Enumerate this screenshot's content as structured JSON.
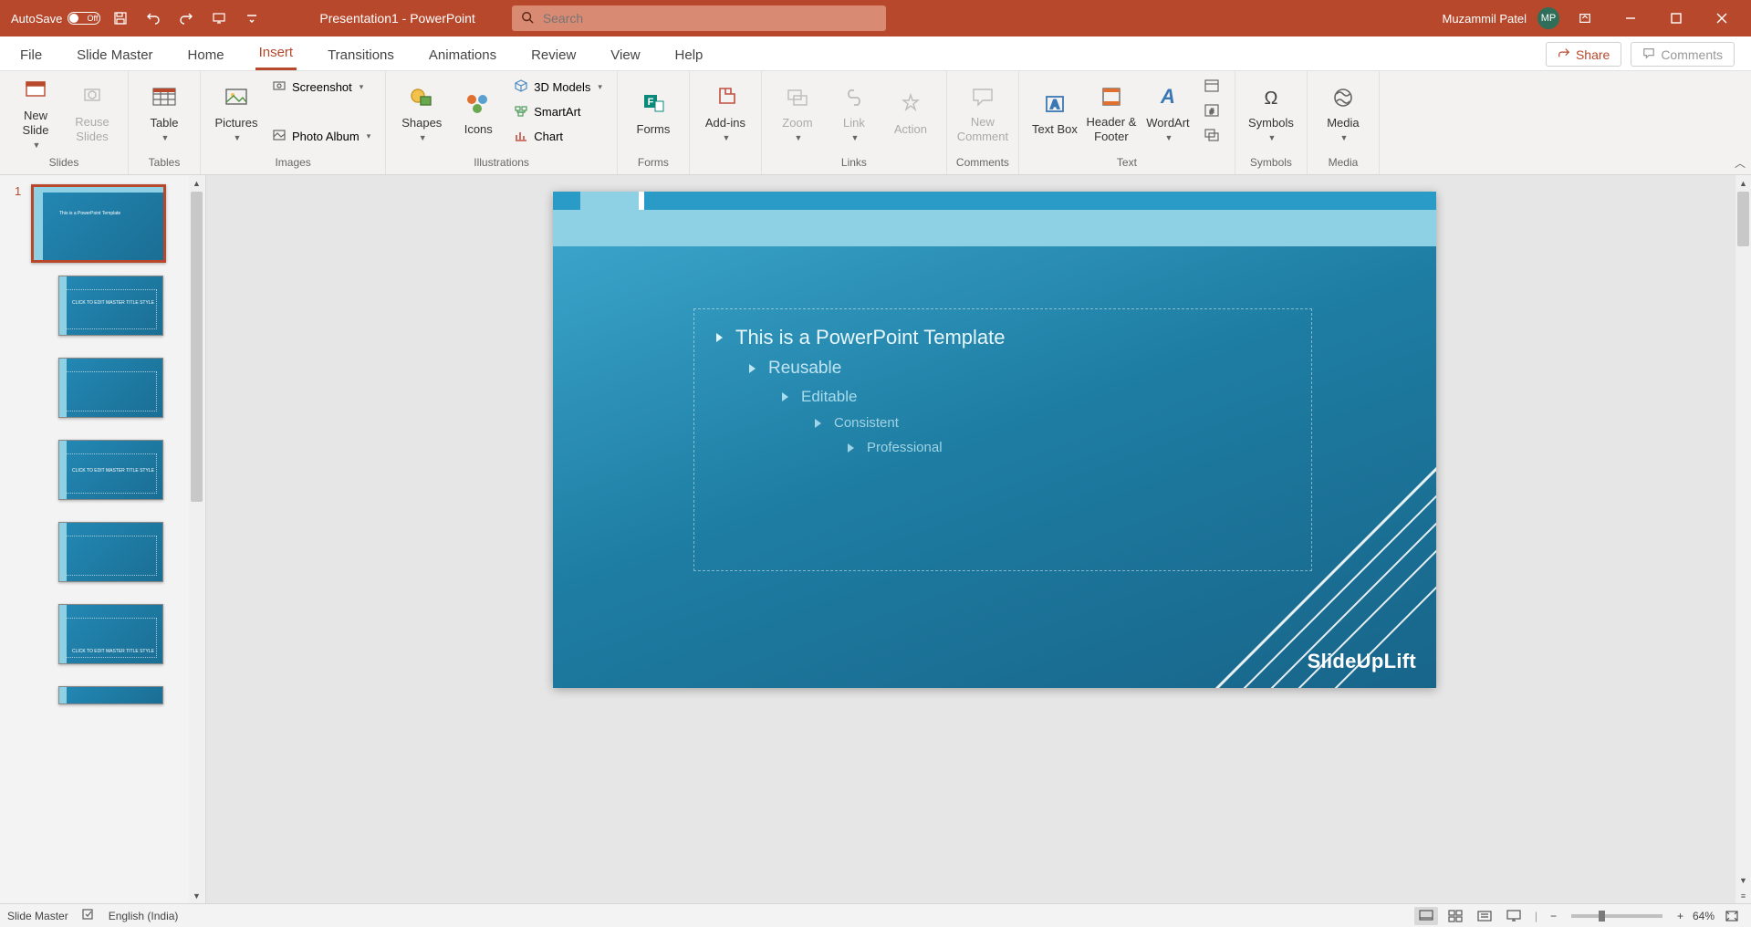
{
  "titlebar": {
    "autosave_label": "AutoSave",
    "autosave_state": "Off",
    "doc_title": "Presentation1 - PowerPoint",
    "search_placeholder": "Search",
    "user_name": "Muzammil Patel",
    "user_initials": "MP"
  },
  "tabs": {
    "file": "File",
    "slidemaster": "Slide Master",
    "home": "Home",
    "insert": "Insert",
    "transitions": "Transitions",
    "animations": "Animations",
    "review": "Review",
    "view": "View",
    "help": "Help",
    "share": "Share",
    "comments": "Comments"
  },
  "ribbon": {
    "groups": {
      "slides": "Slides",
      "tables": "Tables",
      "images": "Images",
      "illustrations": "Illustrations",
      "forms": "Forms",
      "addins_label": "",
      "links": "Links",
      "comments": "Comments",
      "text": "Text",
      "symbols": "Symbols",
      "media": "Media"
    },
    "buttons": {
      "new_slide": "New Slide",
      "reuse_slides": "Reuse Slides",
      "table": "Table",
      "pictures": "Pictures",
      "screenshot": "Screenshot",
      "smartart": "SmartArt",
      "photo_album": "Photo Album",
      "shapes": "Shapes",
      "icons": "Icons",
      "models3d": "3D Models",
      "chart": "Chart",
      "forms": "Forms",
      "addins": "Add-ins",
      "zoom": "Zoom",
      "link": "Link",
      "action": "Action",
      "new_comment": "New Comment",
      "text_box": "Text Box",
      "header_footer": "Header & Footer",
      "wordart": "WordArt",
      "date_time_icon": "",
      "symbols": "Symbols",
      "media": "Media"
    }
  },
  "slidepanel": {
    "active_index": "1"
  },
  "slide": {
    "bullets": {
      "l1": "This is a PowerPoint Template",
      "l2": "Reusable",
      "l3": "Editable",
      "l4": "Consistent",
      "l5": "Professional"
    },
    "brand": "SlideUpLift"
  },
  "thumbnails": {
    "t2_text": "CLICK TO EDIT MASTER TITLE STYLE",
    "t4_text": "CLICK TO EDIT MASTER TITLE STYLE",
    "t6_text": "CLICK TO EDIT MASTER TITLE STYLE"
  },
  "statusbar": {
    "mode": "Slide Master",
    "language": "English (India)",
    "zoom": "64%"
  }
}
